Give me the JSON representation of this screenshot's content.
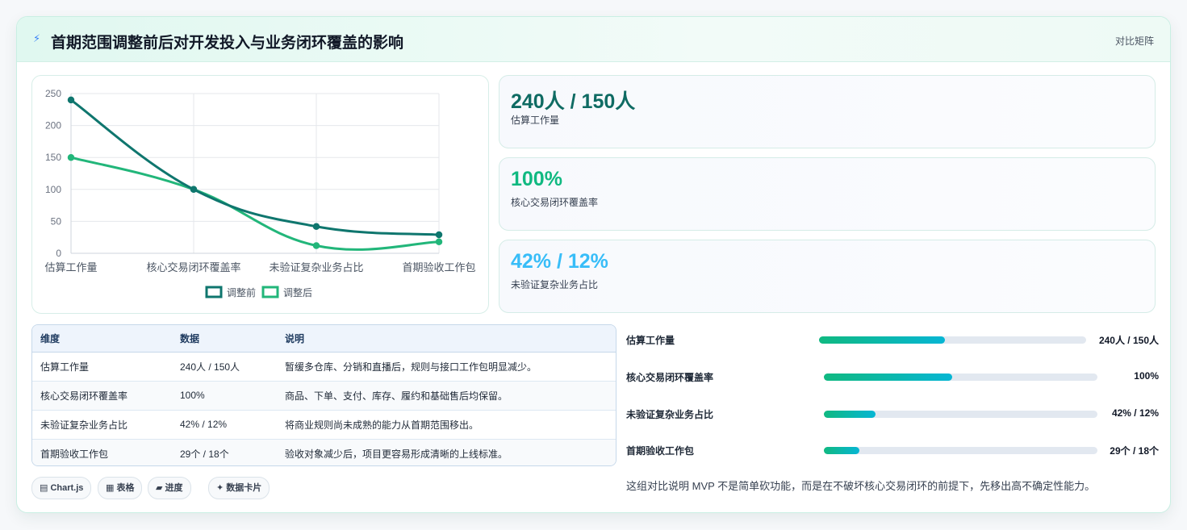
{
  "header": {
    "title": "首期范围调整前后对开发投入与业务闭环覆盖的影响",
    "tag": "对比矩阵",
    "icon": "bolt-icon"
  },
  "chart_data": {
    "type": "line",
    "categories": [
      "估算工作量",
      "核心交易闭环覆盖率",
      "未验证复杂业务占比",
      "首期验收工作包"
    ],
    "series": [
      {
        "name": "调整前",
        "values": [
          240,
          100,
          42,
          29
        ],
        "color": "#0f766e"
      },
      {
        "name": "调整后",
        "values": [
          150,
          100,
          12,
          18
        ],
        "color": "#22b67a"
      }
    ],
    "ylim": [
      0,
      250
    ],
    "yticks": [
      0,
      50,
      100,
      150,
      200,
      250
    ],
    "grid": true,
    "legend": "bottom"
  },
  "kpis": [
    {
      "value": "240人 / 150人",
      "label": "估算工作量",
      "color": "#0f6b63"
    },
    {
      "value": "100%",
      "label": "核心交易闭环覆盖率",
      "color": "#10b981"
    },
    {
      "value": "42% / 12%",
      "label": "未验证复杂业务占比",
      "color": "#38bdf8"
    }
  ],
  "table": {
    "headers": [
      "维度",
      "数据",
      "说明"
    ],
    "rows": [
      [
        "估算工作量",
        "240人 / 150人",
        "暂缓多仓库、分销和直播后，规则与接口工作包明显减少。"
      ],
      [
        "核心交易闭环覆盖率",
        "100%",
        "商品、下单、支付、库存、履约和基础售后均保留。"
      ],
      [
        "未验证复杂业务占比",
        "42% / 12%",
        "将商业规则尚未成熟的能力从首期范围移出。"
      ],
      [
        "首期验收工作包",
        "29个 / 18个",
        "验收对象减少后，项目更容易形成清晰的上线标准。"
      ]
    ]
  },
  "chips": [
    "▤ Chart.js",
    "▦ 表格",
    "▰ 进度",
    "✦ 数据卡片"
  ],
  "progress": [
    {
      "label": "估算工作量",
      "value": "240人 / 150人",
      "fill": 0.47
    },
    {
      "label": "核心交易闭环覆盖率",
      "value": "100%",
      "fill": 0.47
    },
    {
      "label": "未验证复杂业务占比",
      "value": "42% / 12%",
      "fill": 0.19
    },
    {
      "label": "首期验收工作包",
      "value": "29个 / 18个",
      "fill": 0.13
    }
  ],
  "note": "这组对比说明 MVP 不是简单砍功能，而是在不破坏核心交易闭环的前提下，先移出高不确定性能力。"
}
